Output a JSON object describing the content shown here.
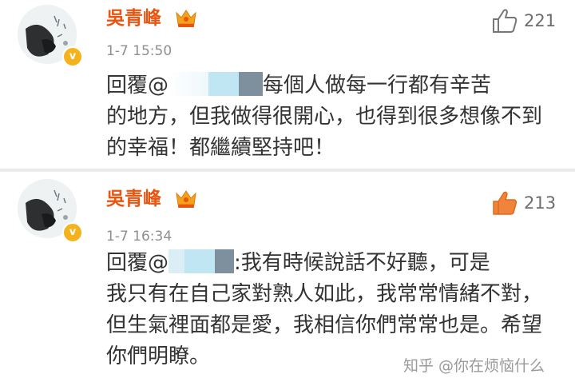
{
  "comments": [
    {
      "username": "吳青峰",
      "time": "1-7 15:50",
      "likes": "221",
      "liked": false,
      "reply_prefix": "回覆@",
      "mention_visible": "",
      "body_line1": "每個人做每一行都有辛苦",
      "body_rest": "的地方，但我做得很開心，也得到很多想像不到的幸福！都繼續堅持吧！"
    },
    {
      "username": "吳青峰",
      "time": "1-7 16:34",
      "likes": "213",
      "liked": true,
      "reply_prefix": "回覆@",
      "mention_visible": "",
      "body_line1": ":我有時候說話不好聽，可是",
      "body_rest": "我只有在自己家對熟人如此，我常常情緒不對，但生氣裡面都是愛，我相信你們常常也是。希望你們明瞭。"
    }
  ],
  "watermark": "知乎 @你在烦恼什么",
  "colors": {
    "username": "#e9550f",
    "like_active": "#f0843a",
    "badge": "#f6b21c"
  },
  "icons": [
    "avatar",
    "verified-badge-icon",
    "vip-crown-icon",
    "thumbs-up-icon"
  ]
}
